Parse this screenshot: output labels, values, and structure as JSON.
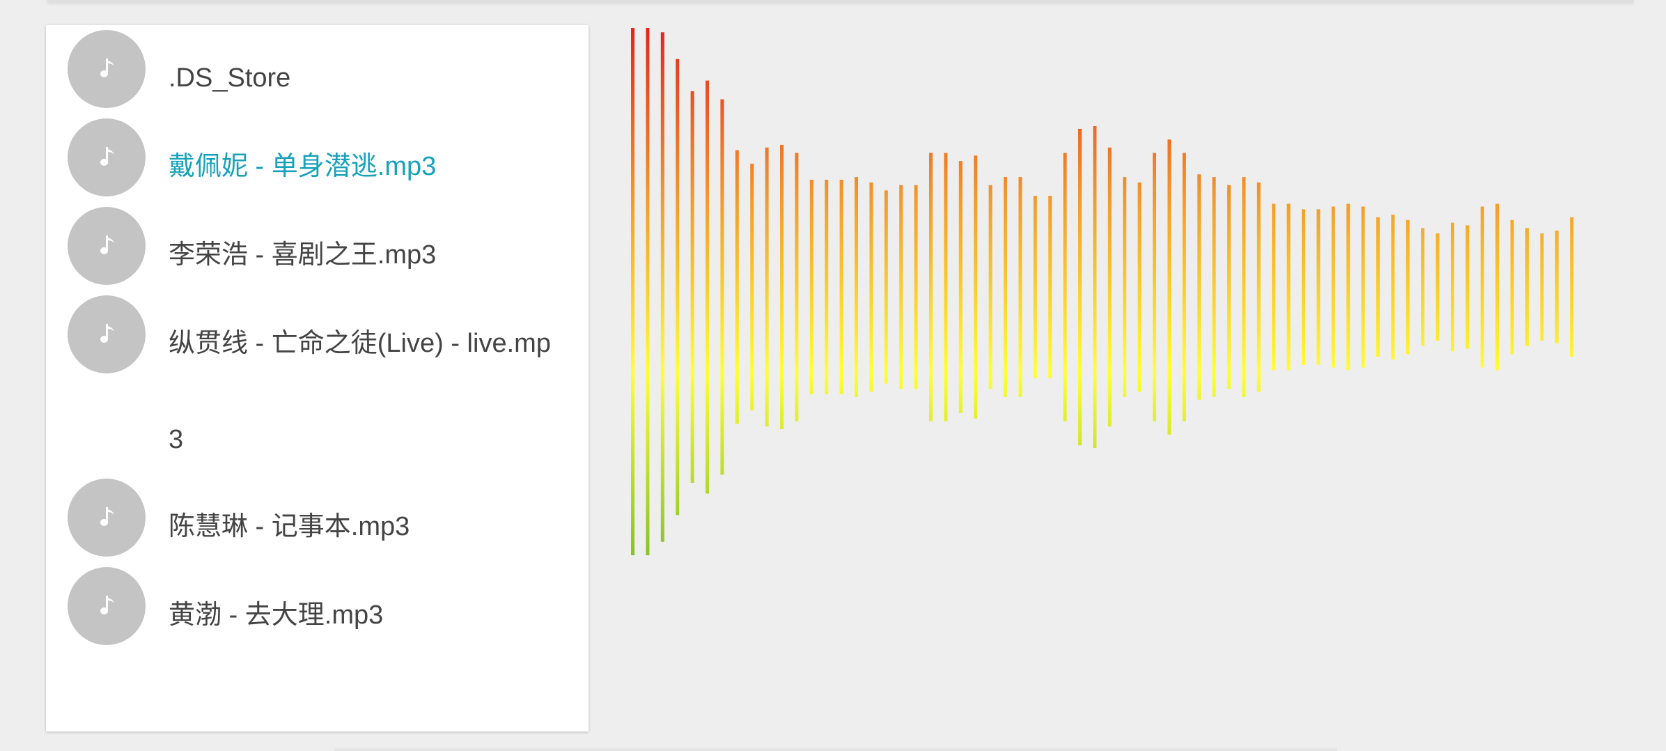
{
  "playlist": {
    "tracks": [
      {
        "name": ".DS_Store",
        "playing": false
      },
      {
        "name": "戴佩妮 - 单身潜逃.mp3",
        "playing": true
      },
      {
        "name": "李荣浩 - 喜剧之王.mp3",
        "playing": false
      },
      {
        "name": "纵贯线 - 亡命之徒(Live) - live.mp3",
        "playing": false
      },
      {
        "name": "陈慧琳 - 记事本.mp3",
        "playing": false
      },
      {
        "name": "黄渤 - 去大理.mp3",
        "playing": false
      }
    ],
    "track_icon": "music-note-icon",
    "active_color": "#17a2b8",
    "text_color": "#444444",
    "avatar_color": "#c4c4c4"
  },
  "visualizer": {
    "type": "bar",
    "bar_count": 64,
    "bar_levels": [
      1.0,
      1.0,
      0.95,
      0.85,
      0.73,
      0.77,
      0.7,
      0.51,
      0.46,
      0.52,
      0.53,
      0.5,
      0.4,
      0.4,
      0.4,
      0.41,
      0.39,
      0.36,
      0.38,
      0.38,
      0.5,
      0.5,
      0.47,
      0.49,
      0.38,
      0.41,
      0.41,
      0.34,
      0.34,
      0.5,
      0.59,
      0.6,
      0.52,
      0.41,
      0.39,
      0.5,
      0.55,
      0.5,
      0.42,
      0.41,
      0.38,
      0.41,
      0.39,
      0.31,
      0.31,
      0.29,
      0.29,
      0.3,
      0.31,
      0.3,
      0.26,
      0.27,
      0.25,
      0.22,
      0.2,
      0.24,
      0.23,
      0.3,
      0.31,
      0.25,
      0.22,
      0.2,
      0.21,
      0.26
    ],
    "colors": {
      "top": "#e3241b",
      "upper": "#f39a2c",
      "middle": "#ffff33",
      "bottom": "#1f8a1f"
    }
  }
}
